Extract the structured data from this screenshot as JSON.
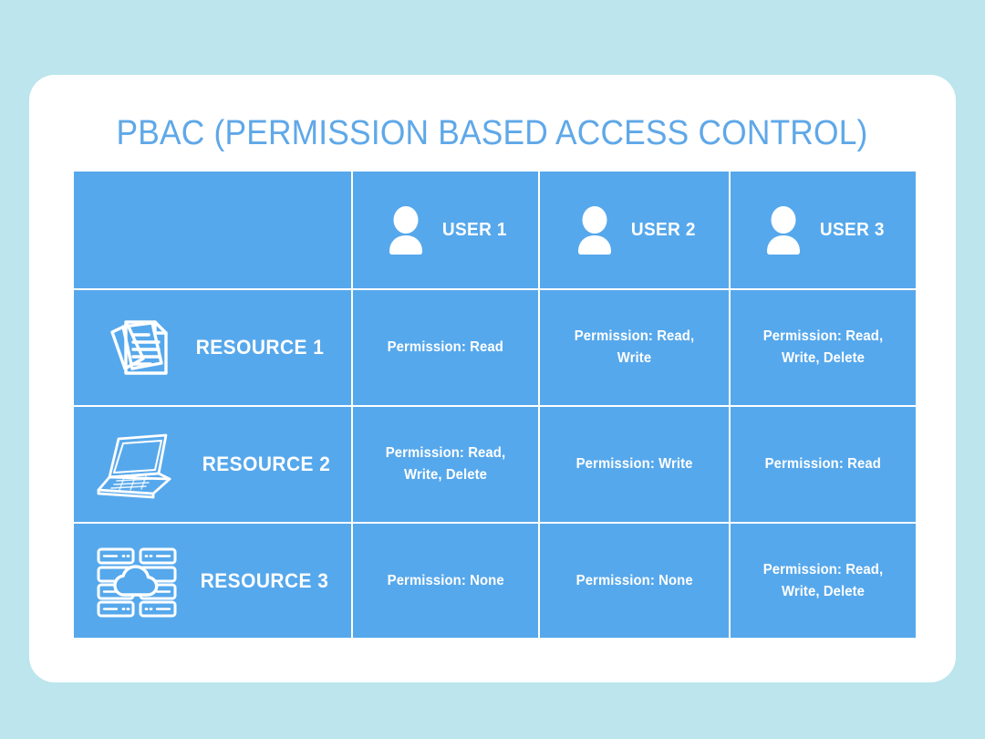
{
  "theme": {
    "page_background": "#bce5ed",
    "card_background": "#ffffff",
    "cell_blue": "#56a8ec",
    "title_blue": "#5fa8e8",
    "text_white": "#ffffff"
  },
  "page_title": "PBAC (Permission Based Access Control)",
  "matrix": {
    "corner_label": "",
    "columns": [
      {
        "id": "user-1",
        "label": "USER 1",
        "icon": "user-icon"
      },
      {
        "id": "user-2",
        "label": "USER 2",
        "icon": "user-icon"
      },
      {
        "id": "user-3",
        "label": "USER 3",
        "icon": "user-icon"
      }
    ],
    "rows": [
      {
        "id": "resource-1",
        "label": "RESOURCE 1",
        "icon": "documents-icon",
        "permissions": [
          "Permission: Read",
          "Permission: Read, Write",
          "Permission: Read, Write, Delete"
        ]
      },
      {
        "id": "resource-2",
        "label": "RESOURCE 2",
        "icon": "laptop-icon",
        "permissions": [
          "Permission: Read, Write, Delete",
          "Permission: Write",
          "Permission: Read"
        ]
      },
      {
        "id": "resource-3",
        "label": "RESOURCE 3",
        "icon": "servers-cloud-icon",
        "permissions": [
          "Permission: None",
          "Permission: None",
          "Permission: Read, Write, Delete"
        ]
      }
    ]
  }
}
